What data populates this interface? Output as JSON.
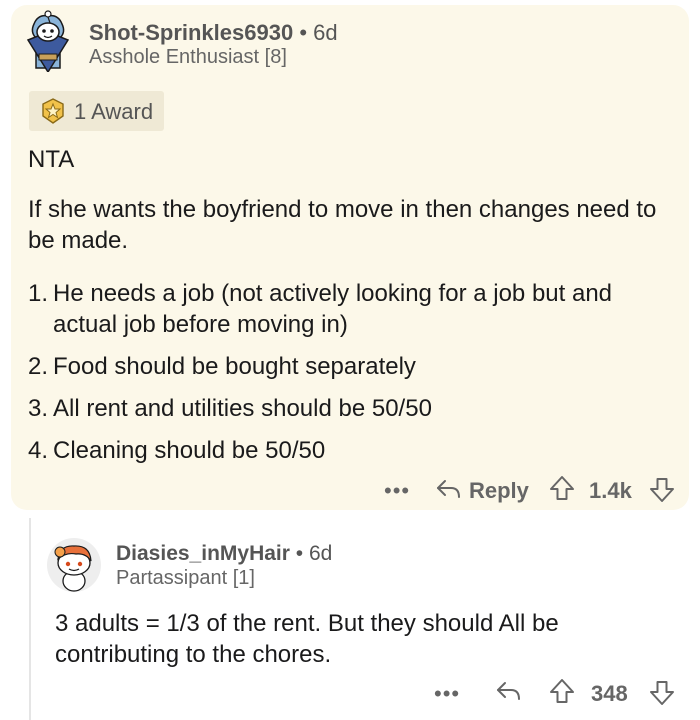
{
  "comment": {
    "username": "Shot-Sprinkles6930",
    "separator": "•",
    "age": "6d",
    "flair": "Asshole Enthusiast [8]",
    "award_label": "1 Award",
    "verdict": "NTA",
    "paragraph": "If she wants the boyfriend to move in then changes need to be made.",
    "list": [
      {
        "num": "1.",
        "text": "He needs a job (not actively looking for a job but and actual job before moving in)"
      },
      {
        "num": "2.",
        "text": "Food should be bought separately"
      },
      {
        "num": "3.",
        "text": "All rent and utilities should be 50/50"
      },
      {
        "num": "4.",
        "text": "Cleaning should be 50/50"
      }
    ],
    "actions": {
      "more": "•••",
      "reply_label": "Reply",
      "score": "1.4k"
    }
  },
  "reply": {
    "username": "Diasies_inMyHair",
    "separator": "•",
    "age": "6d",
    "flair": "Partassipant [1]",
    "text": "3 adults = 1/3 of the rent. But they should All be contributing to the chores.",
    "actions": {
      "more": "•••",
      "score": "348"
    }
  },
  "colors": {
    "card_background": "#fcf8e9",
    "award_background": "#efe9d5",
    "meta_text": "#666666",
    "body_text": "#1a1a1b"
  },
  "icons": [
    "snoo-avatar-icon",
    "award-icon",
    "reply-arrow-icon",
    "upvote-icon",
    "downvote-icon",
    "more-icon"
  ]
}
